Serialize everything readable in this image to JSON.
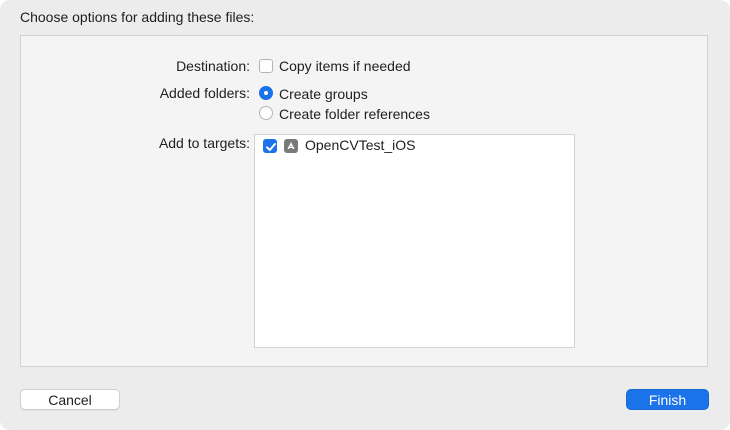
{
  "dialog": {
    "title": "Choose options for adding these files:"
  },
  "destination": {
    "label": "Destination:",
    "copy_items_label": "Copy items if needed",
    "copy_items_checked": false
  },
  "added_folders": {
    "label": "Added folders:",
    "options": [
      {
        "label": "Create groups",
        "selected": true
      },
      {
        "label": "Create folder references",
        "selected": false
      }
    ]
  },
  "targets": {
    "label": "Add to targets:",
    "items": [
      {
        "name": "OpenCVTest_iOS",
        "checked": true,
        "icon": "app-target-icon"
      }
    ]
  },
  "footer": {
    "cancel_label": "Cancel",
    "finish_label": "Finish"
  },
  "colors": {
    "accent": "#1a73e8",
    "dialog_bg": "#ececec",
    "panel_bg": "#f4f4f4"
  }
}
